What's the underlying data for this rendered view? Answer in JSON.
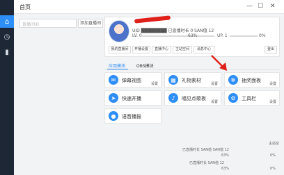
{
  "window": {
    "title": "首页"
  },
  "search": {
    "placeholder": "直播间ID",
    "add_label": "添加直播间"
  },
  "user": {
    "uid_text": "UID ████████ 已直播时长 0 SAN值 12",
    "lv_label": "LV. 0",
    "lv_percent": "63%",
    "up_label": "UP. 1",
    "up_percent": "0%"
  },
  "user_buttons": [
    "我的直播间",
    "开播设置",
    "直播中心",
    "主站空间",
    "消息中心"
  ],
  "logout_label": "登出",
  "tabs": {
    "active": "应用模块",
    "other": "OBS模块"
  },
  "tiles": [
    {
      "label": "弹幕视图",
      "setting": "设置",
      "icon": "chat-icon"
    },
    {
      "label": "礼物素材",
      "setting": "设置",
      "icon": "gift-icon"
    },
    {
      "label": "抽奖面板",
      "setting": "设置",
      "icon": "snowflake-icon"
    },
    {
      "label": "快速开播",
      "setting": "",
      "icon": "send-icon"
    },
    {
      "label": "唱见点歌板",
      "setting": "设置",
      "icon": "music-icon"
    },
    {
      "label": "工具栏",
      "setting": "设置",
      "icon": "gear-icon"
    },
    {
      "label": "语音播报",
      "setting": "",
      "icon": "mic-icon"
    }
  ],
  "peek": {
    "side_label": "主站空",
    "line1": "已直播时长 SAN值 SAN值 12",
    "pct_a": "63%",
    "pct_b": "0%",
    "line2": "已直播时长 SAN值 12",
    "pct_c": "63%",
    "pct_d": "0%"
  }
}
